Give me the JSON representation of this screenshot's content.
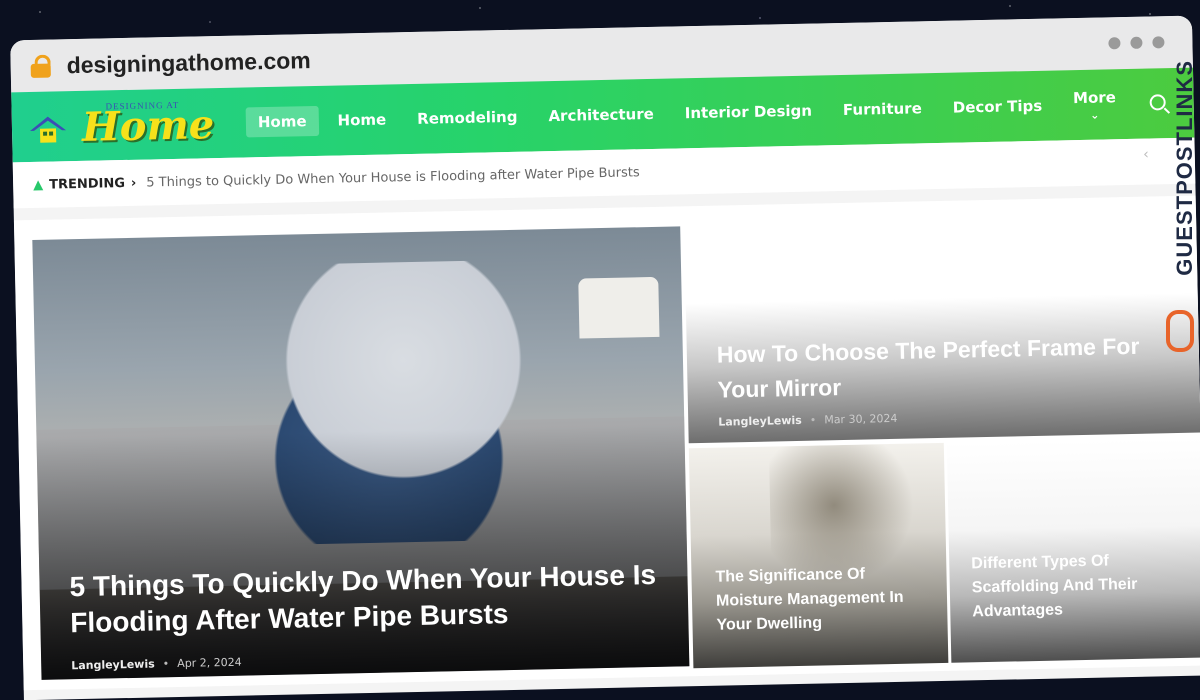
{
  "browser": {
    "url": "designingathome.com",
    "lock_icon": "lock-icon"
  },
  "logo": {
    "small_text": "DESIGNING AT",
    "big_text": "Home"
  },
  "nav": {
    "items": [
      {
        "label": "Home",
        "active": true
      },
      {
        "label": "Home",
        "active": false
      },
      {
        "label": "Remodeling",
        "active": false
      },
      {
        "label": "Architecture",
        "active": false
      },
      {
        "label": "Interior Design",
        "active": false
      },
      {
        "label": "Furniture",
        "active": false
      },
      {
        "label": "Decor Tips",
        "active": false
      }
    ],
    "more_label": "More",
    "accent": "#27d36a"
  },
  "trending": {
    "label": "TRENDING",
    "arrow": "›",
    "headline": "5 Things to Quickly Do When Your House is Flooding after Water Pipe Bursts"
  },
  "posts": {
    "hero": {
      "title": "5 Things To Quickly Do When Your House Is Flooding After Water Pipe Bursts",
      "author": "LangleyLewis",
      "date": "Apr 2, 2024"
    },
    "side_top": {
      "title": "How To Choose The Perfect Frame For Your Mirror",
      "author": "LangleyLewis",
      "date": "Mar 30, 2024"
    },
    "small_one": {
      "title": "The Significance Of Moisture Management In Your Dwelling"
    },
    "small_two": {
      "title": "Different Types Of Scaffolding And Their Advantages"
    }
  },
  "watermark": {
    "text": "GUESTPOSTLINKS"
  }
}
